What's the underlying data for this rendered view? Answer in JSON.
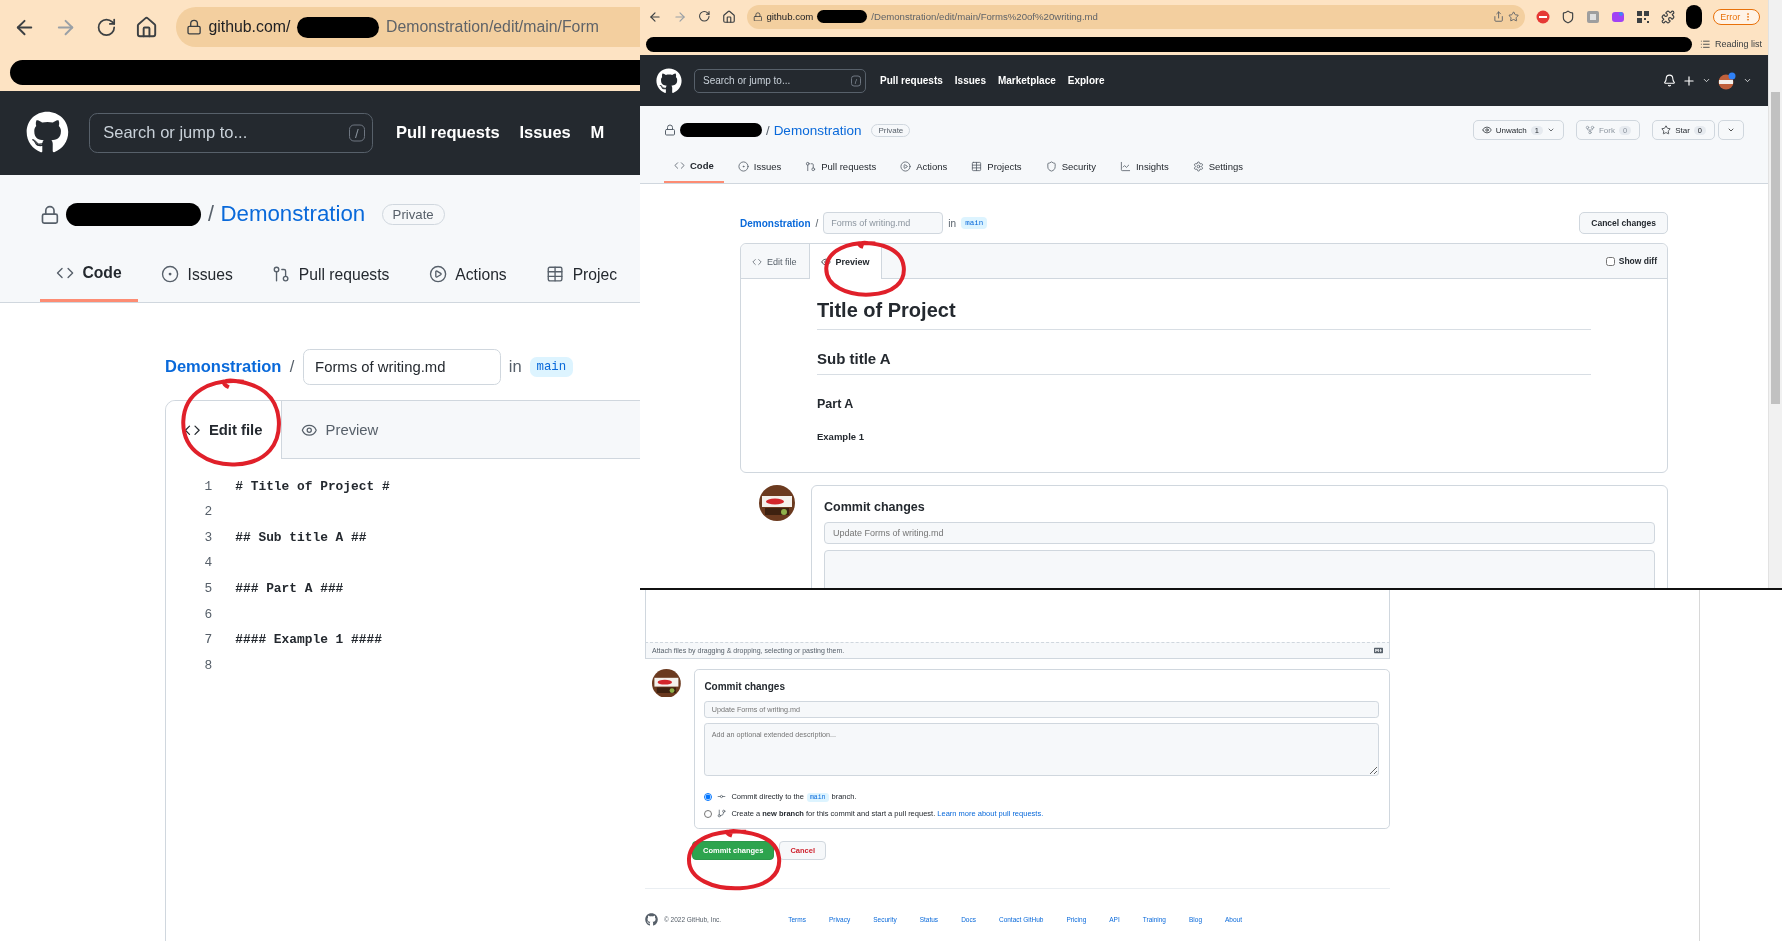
{
  "left_view": {
    "browser": {
      "url_host": "github.com/",
      "url_path": "Demonstration/edit/main/Form"
    },
    "header": {
      "search_placeholder": "Search or jump to...",
      "search_key": "/",
      "nav": [
        "Pull requests",
        "Issues",
        "M"
      ]
    },
    "repo": {
      "separator": "/",
      "name": "Demonstration",
      "visibility": "Private"
    },
    "tabs": [
      {
        "kind": "code",
        "label": "Code",
        "selected": true
      },
      {
        "kind": "issues",
        "label": "Issues",
        "selected": false
      },
      {
        "kind": "pulls",
        "label": "Pull requests",
        "selected": false
      },
      {
        "kind": "actions",
        "label": "Actions",
        "selected": false
      },
      {
        "kind": "projects",
        "label": "Projec",
        "selected": false
      }
    ],
    "breadcrumb": {
      "repo": "Demonstration",
      "separator": "/",
      "filename": "Forms of writing.md",
      "in": "in",
      "branch": "main"
    },
    "editor_tabs": [
      {
        "kind": "edit",
        "label": "Edit file",
        "selected": true
      },
      {
        "kind": "preview",
        "label": "Preview",
        "selected": false
      }
    ],
    "code_lines": [
      {
        "number": "1",
        "text": "# Title of Project #"
      },
      {
        "number": "2"
      },
      {
        "number": "3",
        "text": "## Sub title A ##"
      },
      {
        "number": "4"
      },
      {
        "number": "5",
        "text": "### Part A ###"
      },
      {
        "number": "6"
      },
      {
        "number": "7",
        "text": "#### Example 1 ####"
      },
      {
        "number": "8"
      }
    ]
  },
  "top_right_view": {
    "browser": {
      "url_host": "github.com",
      "url_path": "/Demonstration/edit/main/Forms%20of%20writing.md",
      "status": "Error",
      "bookmark": "Reading list"
    },
    "header": {
      "search_placeholder": "Search or jump to...",
      "search_key": "/",
      "nav": [
        "Pull requests",
        "Issues",
        "Marketplace",
        "Explore"
      ]
    },
    "repo": {
      "separator": "/",
      "name": "Demonstration",
      "visibility": "Private",
      "actions": [
        {
          "kind": "watch",
          "label": "Unwatch",
          "count": "1",
          "disabled": false
        },
        {
          "kind": "fork",
          "label": "Fork",
          "count": "0",
          "disabled": true
        },
        {
          "kind": "star",
          "label": "Star",
          "count": "0",
          "disabled": false
        }
      ]
    },
    "tabs": [
      {
        "kind": "code",
        "label": "Code",
        "selected": true
      },
      {
        "kind": "issues",
        "label": "Issues",
        "selected": false
      },
      {
        "kind": "pulls",
        "label": "Pull requests",
        "selected": false
      },
      {
        "kind": "actions",
        "label": "Actions",
        "selected": false
      },
      {
        "kind": "projects",
        "label": "Projects",
        "selected": false
      },
      {
        "kind": "security",
        "label": "Security",
        "selected": false
      },
      {
        "kind": "insights",
        "label": "Insights",
        "selected": false
      },
      {
        "kind": "settings",
        "label": "Settings",
        "selected": false
      }
    ],
    "breadcrumb": {
      "repo": "Demonstration",
      "separator": "/",
      "filename": "Forms of writing.md",
      "in": "in",
      "branch": "main",
      "cancel": "Cancel changes"
    },
    "editor_tabs": [
      {
        "kind": "edit",
        "label": "Edit file",
        "selected": false
      },
      {
        "kind": "preview",
        "label": "Preview",
        "selected": true
      }
    ],
    "show_diff": {
      "label": "Show diff",
      "checked": false
    },
    "preview": [
      {
        "kind": "h1",
        "text": "Title of Project"
      },
      {
        "kind": "h2",
        "text": "Sub title A"
      },
      {
        "kind": "h3",
        "text": "Part A"
      },
      {
        "kind": "h4",
        "text": "Example 1"
      }
    ],
    "commit": {
      "title": "Commit changes",
      "summary_placeholder": "Update Forms of writing.md"
    }
  },
  "bottom_right_view": {
    "attach_hint": "Attach files by dragging & dropping, selecting or pasting them.",
    "commit": {
      "title": "Commit changes",
      "summary_placeholder": "Update Forms of writing.md",
      "description_placeholder": "Add an optional extended description..."
    },
    "options": [
      {
        "kind": "direct",
        "text_before": "Commit directly to the",
        "branch": "main",
        "text_after": "branch.",
        "selected": true
      },
      {
        "kind": "new_branch",
        "text": "Create a **new branch** for this commit and start a pull request.",
        "link": "Learn more about pull requests.",
        "selected": false
      }
    ],
    "buttons": [
      {
        "kind": "primary",
        "label": "Commit changes"
      },
      {
        "kind": "danger",
        "label": "Cancel"
      }
    ],
    "footer": {
      "copyright": "© 2022 GitHub, Inc.",
      "links": [
        "Terms",
        "Privacy",
        "Security",
        "Status",
        "Docs",
        "Contact GitHub",
        "Pricing",
        "API",
        "Training",
        "Blog",
        "About"
      ]
    }
  }
}
